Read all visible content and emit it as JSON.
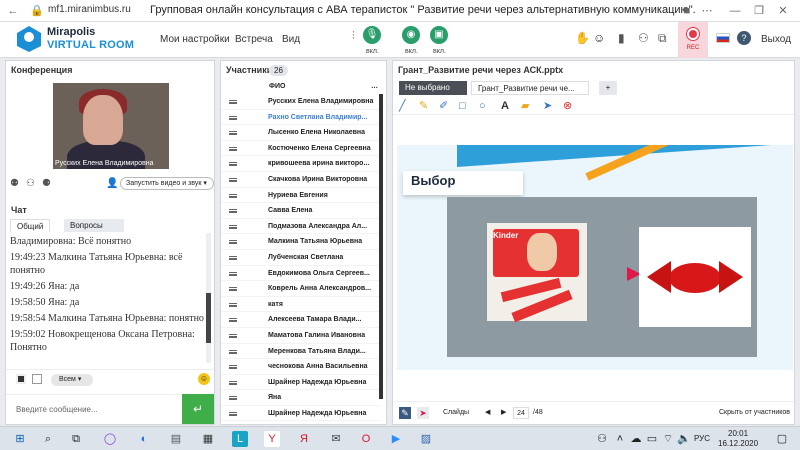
{
  "browser": {
    "url": "mf1.miranimbus.ru",
    "page_title": "Групповая онлайн консультация с АВА тераписток \" Развитие речи через альтернативную коммуникацию\"."
  },
  "header": {
    "logo_line1": "Mirapolis",
    "logo_line2": "VIRTUAL ROOM",
    "menu": [
      "Мои настройки",
      "Встреча",
      "Вид"
    ],
    "mic_label": "вкл.",
    "cam_label": "вкл.",
    "screen_label": "вкл.",
    "rec_label": "REC",
    "exit_label": "Выход"
  },
  "conference": {
    "title": "Конференция",
    "video_name": "Русских Елена Владимировна",
    "start_video_label": "Запустить видео и звук"
  },
  "chat": {
    "title": "Чат",
    "tabs": [
      "Общий",
      "Вопросы"
    ],
    "messages": [
      "Владимировна: Всё понятно",
      "19:49:23 Малкина Татьяна Юрьевна: всё понятно",
      "19:49:26 Яна: да",
      "19:58:50 Яна: да",
      "19:58:54 Малкина Татьяна Юрьевна: понятно",
      "19:59:02 Новокрещенова Оксана Петровна: Понятно"
    ],
    "recipient": "Всем",
    "input_placeholder": "Введите сообщение..."
  },
  "participants": {
    "title": "Участники",
    "count": "26",
    "column_header": "ФИО",
    "list": [
      "Русских Елена Владимировна",
      "Рахно Светлана Владимир...",
      "Лысенко Елена Николаевна",
      "Костюченко Елена Сергеевна",
      "кривошеева ирина викторо...",
      "Скачкова Ирина Викторовна",
      "Нуриева Евгения",
      "Савва Елена",
      "Подмазова Александра Ал...",
      "Малкина Татьяна Юрьевна",
      "Лубченская Светлана",
      "Евдокимова Ольга Сергеев...",
      "Коврель Анна Александров...",
      "катя",
      "Алексеева Тамара Влади...",
      "Маматова Галина Ивановна",
      "Меренкова Татьяна Влади...",
      "чеснокова Анна Васильевна",
      "Шрайнер Надежда Юрьевна",
      "Яна",
      "Шрайнер Надежда Юрьевна"
    ]
  },
  "presentation": {
    "title": "Грант_Развитие речи через АСК.pptx",
    "tabs": [
      "Не выбрано",
      "Грант_Развитие речи че...",
      "+"
    ],
    "slide_title": "Выбор",
    "kinder_text": "Kinder",
    "slides_label": "Слайды",
    "current_slide": "24",
    "total_slides": "/48",
    "hide_participants": "Скрыть от участников"
  },
  "taskbar": {
    "time": "20:01",
    "date": "16.12.2020",
    "lang": "РУС"
  }
}
